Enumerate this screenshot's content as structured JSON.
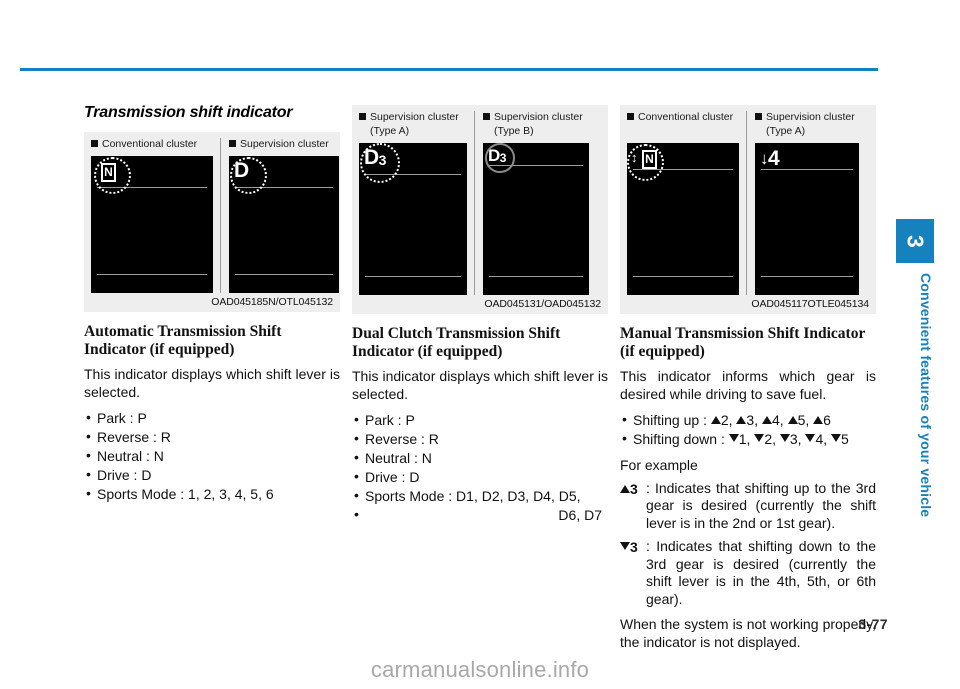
{
  "page": {
    "number": "3-77",
    "watermark": "carmanualsonline.info",
    "accent_color": "#0f82c3"
  },
  "side_tab": {
    "chapter": "3",
    "label": "Convenient features of your vehicle",
    "color": "#1581bd"
  },
  "section": {
    "title": "Transmission shift indicator"
  },
  "figures": {
    "automatic": {
      "code": "OAD045185N/OTL045132",
      "panels": [
        {
          "caption": "Conventional cluster",
          "glyph": "N",
          "glyph_type": "boxed-n",
          "ring": "dotted"
        },
        {
          "caption": "Supervision cluster",
          "glyph": "D",
          "glyph_type": "letter",
          "ring": "dotted"
        }
      ]
    },
    "dual_clutch": {
      "code": "OAD045131/OAD045132",
      "panels": [
        {
          "caption": "Supervision cluster",
          "caption2": "(Type A)",
          "glyph": "D",
          "glyph_sub": "3",
          "glyph_type": "letter-sub",
          "ring": "dotted"
        },
        {
          "caption": "Supervision cluster",
          "caption2": "(Type B)",
          "glyph": "D",
          "glyph_sub": "3",
          "glyph_type": "letter-sub",
          "ring": "solid"
        }
      ]
    },
    "manual": {
      "code": "OAD045117OTLE045134",
      "panels": [
        {
          "caption": "Conventional cluster",
          "glyph": "N",
          "glyph_type": "updown-boxed-n",
          "ring": "dotted"
        },
        {
          "caption": "Supervision cluster",
          "caption2": "(Type A)",
          "glyph": "4",
          "glyph_arrow": "↓",
          "glyph_type": "arrow-num",
          "ring": "none"
        }
      ]
    }
  },
  "columns": {
    "automatic": {
      "heading": "Automatic Transmission Shift Indicator (if equipped)",
      "intro": "This indicator displays which shift lever is selected.",
      "bullets": [
        "Park : P",
        "Reverse : R",
        "Neutral : N",
        "Drive : D",
        "Sports Mode : 1, 2, 3, 4, 5, 6"
      ]
    },
    "dual_clutch": {
      "heading": "Dual Clutch Transmission Shift Indicator (if equipped)",
      "intro": "This indicator displays which shift lever is selected.",
      "bullets": [
        "Park : P",
        "Reverse : R",
        "Neutral : N",
        "Drive : D",
        "Sports Mode : D1, D2, D3, D4, D5,"
      ],
      "bullet_continuation": "D6, D7"
    },
    "manual": {
      "heading": "Manual Transmission Shift Indicator (if equipped)",
      "intro": "This indicator informs which gear is desired while driving to save fuel.",
      "shift_up_label": "Shifting up : ",
      "shift_up_values": "2, 3, 4, 5, 6",
      "shift_down_label": "Shifting down : ",
      "shift_down_values": "1, 2, 3, 4, 5",
      "for_example": "For example",
      "example_up_mark": "3",
      "example_up_text": "Indicates that shifting up to the 3rd gear is desired (currently the shift lever is in the 2nd or 1st gear).",
      "example_down_mark": "3",
      "example_down_text": "Indicates that shifting down to the 3rd gear is desired (currently the shift lever is in the 4th, 5th, or 6th gear).",
      "closing": "When the system is not working properly, the indicator is not displayed."
    }
  }
}
